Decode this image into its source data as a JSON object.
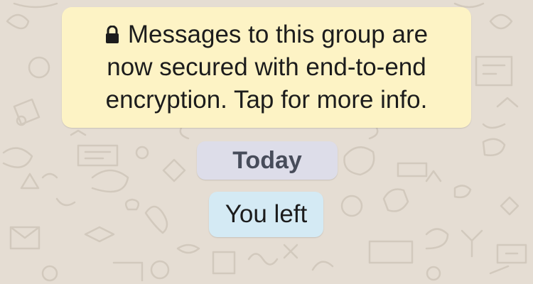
{
  "chat": {
    "encryption_notice": {
      "icon": "lock-icon",
      "line1": "Messages to this group are",
      "line2": "now secured with end-to-end",
      "line3": "encryption. Tap for more info."
    },
    "date_separator": "Today",
    "system_message": "You left"
  },
  "colors": {
    "wallpaper": "#e5ddd3",
    "notice_background": "#fdf3c5",
    "date_background": "#dddde9",
    "system_message_background": "#d4eaf4"
  }
}
